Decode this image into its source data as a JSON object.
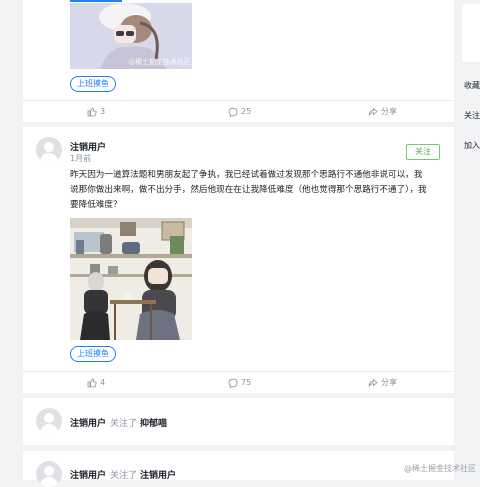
{
  "feed": {
    "post1": {
      "tag": "上班摸鱼",
      "image_watermark": "@稀土掘金技术社区",
      "actions": {
        "likes": "3",
        "comments": "25",
        "share": "分享"
      }
    },
    "post2": {
      "user": "注销用户",
      "time": "1月前",
      "follow_label": "关注",
      "content": "昨天因为一道算法题和男朋友起了争执，我已经试着做过发现那个思路行不通他非说可以，我说那你做出来啊，做不出分手，然后他现在在让我降低难度（他也觉得那个思路行不通了），我要降低难度？",
      "tag": "上班摸鱼",
      "actions": {
        "likes": "4",
        "comments": "75",
        "share": "分享"
      }
    },
    "activity1": {
      "user": "注销用户",
      "verb": "关注了",
      "target": "抑郁喵"
    },
    "activity2": {
      "user": "注销用户",
      "verb": "关注了",
      "target": "注销用户"
    }
  },
  "right_sidebar": {
    "items": [
      "收藏",
      "关注",
      "加入"
    ]
  },
  "watermark": "@稀土掘金技术社区",
  "colors": {
    "accent": "#1e80ff",
    "follow": "#4caf50",
    "bg": "#f2f3f5"
  }
}
